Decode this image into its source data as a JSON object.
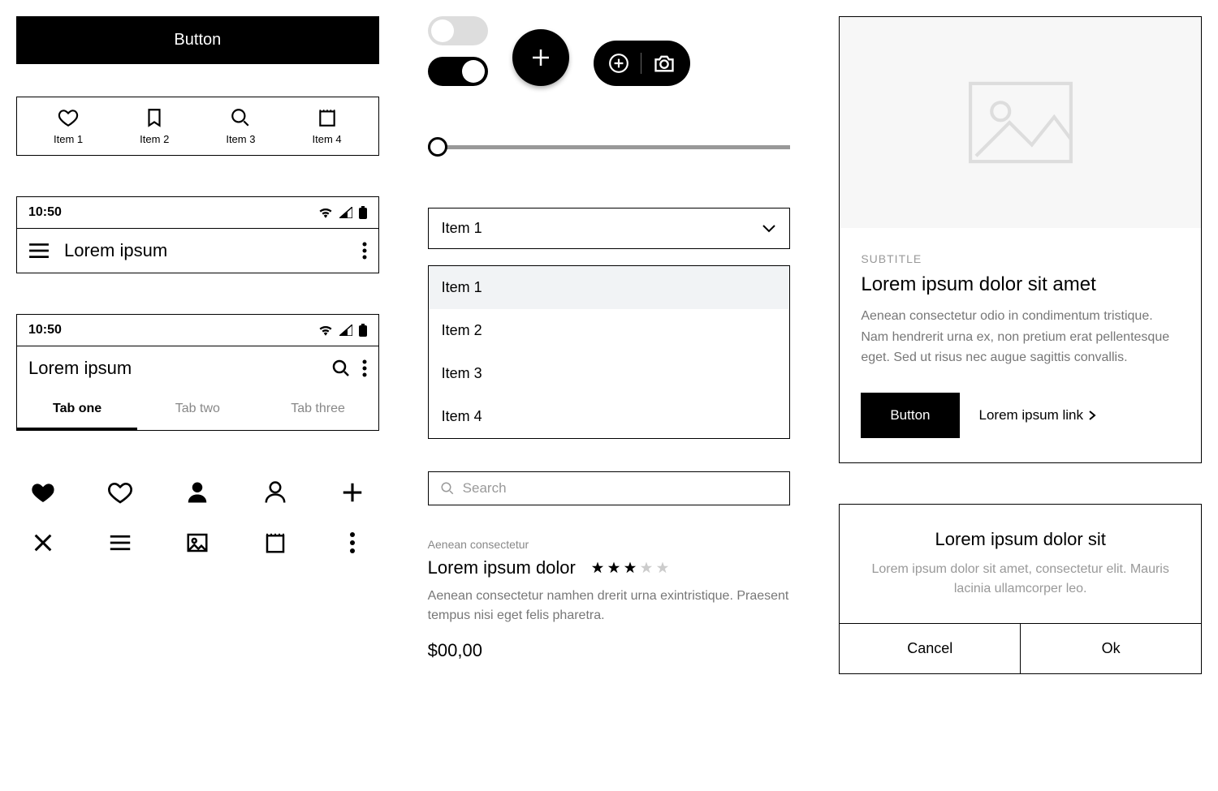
{
  "primary_button": "Button",
  "navbar": [
    "Item 1",
    "Item 2",
    "Item 3",
    "Item 4"
  ],
  "statusbar": {
    "time": "10:50"
  },
  "screen1": {
    "title": "Lorem ipsum"
  },
  "screen2": {
    "title": "Lorem ipsum",
    "tabs": [
      "Tab one",
      "Tab two",
      "Tab three"
    ]
  },
  "dropdown": {
    "selected": "Item 1"
  },
  "list": [
    "Item 1",
    "Item 2",
    "Item 3",
    "Item 4"
  ],
  "search_placeholder": "Search",
  "product": {
    "breadcrumb": "Aenean consectetur",
    "title": "Lorem ipsum dolor",
    "rating": 3,
    "max_rating": 5,
    "desc": "Aenean consectetur namhen drerit urna exintristique. Praesent tempus nisi eget felis pharetra.",
    "price": "$00,00"
  },
  "card": {
    "subtitle": "SUBTITLE",
    "title": "Lorem ipsum dolor sit amet",
    "desc": "Aenean consectetur odio in condimentum tristique. Nam hendrerit urna ex, non pretium erat pellentesque eget. Sed ut risus nec augue sagittis convallis.",
    "button": "Button",
    "link": "Lorem ipsum link"
  },
  "dialog": {
    "title": "Lorem ipsum dolor sit",
    "desc": "Lorem ipsum dolor sit amet, consectetur elit. Mauris lacinia ullamcorper leo.",
    "cancel": "Cancel",
    "ok": "Ok"
  }
}
